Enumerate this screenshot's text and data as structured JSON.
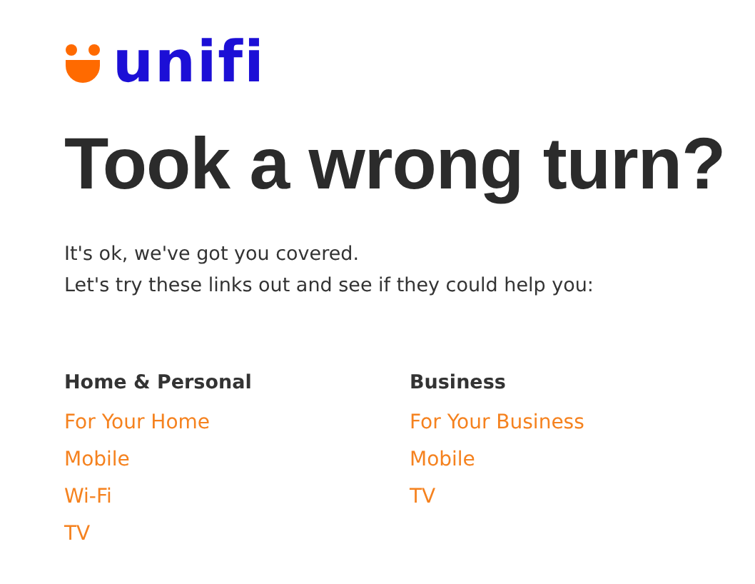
{
  "logo": {
    "text": "unifi"
  },
  "heading": "Took a wrong turn?",
  "intro": [
    "It's ok, we've got you covered.",
    "Let's try these links out and see if they could help you:"
  ],
  "columns": [
    {
      "title": "Home & Personal",
      "links": [
        "For Your Home",
        "Mobile",
        "Wi-Fi",
        "TV"
      ]
    },
    {
      "title": "Business",
      "links": [
        "For Your Business",
        "Mobile",
        "TV"
      ]
    }
  ]
}
